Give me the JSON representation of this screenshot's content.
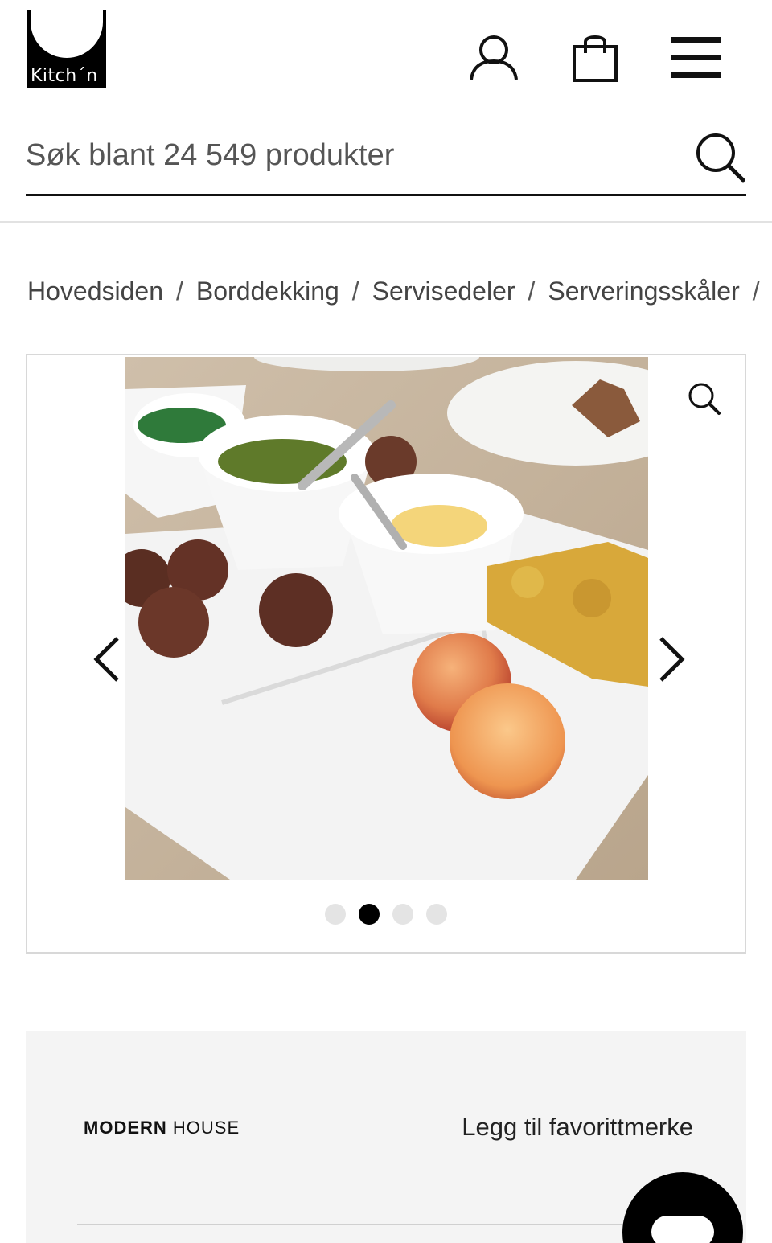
{
  "header": {
    "logo_text": "Kitch´n",
    "icons": [
      "user-icon",
      "shopping-bag-icon",
      "menu-icon"
    ]
  },
  "search": {
    "placeholder": "Søk blant 24 549 produkter",
    "icon": "search-icon"
  },
  "breadcrumb": {
    "items": [
      "Hovedsiden",
      "Borddekking",
      "Servisedeler",
      "Serverings­skåler"
    ],
    "separator": "/"
  },
  "gallery": {
    "image_description_icon": "zoom-icon",
    "current_slide": 2,
    "slide_count": 4
  },
  "product": {
    "brand_bold": "MODERN",
    "brand_regular": "HOUSE",
    "favorite_label": "Legg til favorittmerke"
  },
  "colors": {
    "accent": "#000000",
    "panel_bg": "#f4f4f4",
    "dot_inactive": "#e4e4e4"
  }
}
